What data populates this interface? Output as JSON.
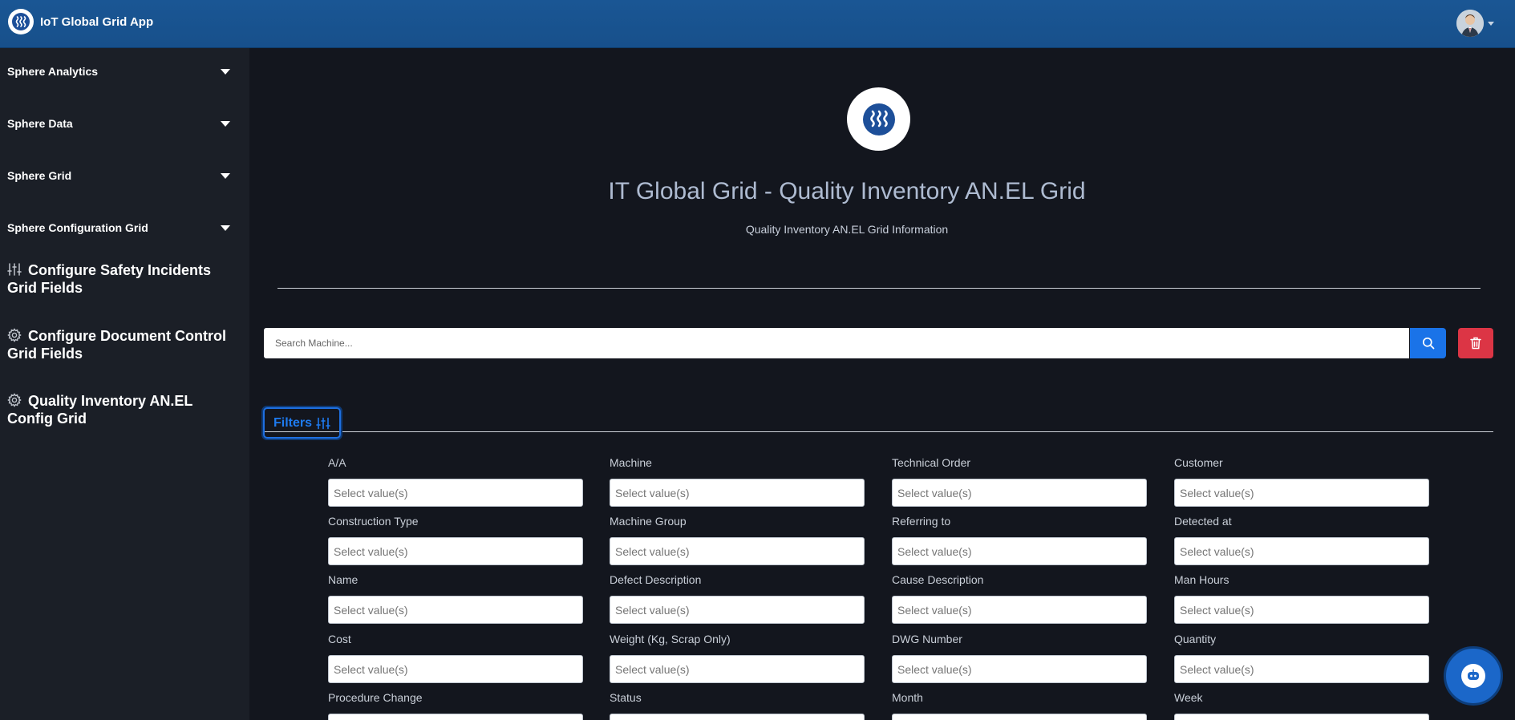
{
  "app": {
    "title": "IoT Global Grid App"
  },
  "sidebar": {
    "groups": [
      {
        "label": "Sphere Analytics"
      },
      {
        "label": "Sphere Data"
      },
      {
        "label": "Sphere Grid"
      },
      {
        "label": "Sphere Configuration Grid"
      }
    ],
    "links": [
      {
        "label": "Configure Safety Incidents Grid Fields",
        "icon": "sliders-icon"
      },
      {
        "label": "Configure Document Control Grid Fields",
        "icon": "gear-icon"
      },
      {
        "label": "Quality Inventory AN.EL Config Grid",
        "icon": "gear-icon"
      }
    ]
  },
  "hero": {
    "title": "IT Global Grid - Quality Inventory AN.EL Grid",
    "subtitle": "Quality Inventory AN.EL Grid Information"
  },
  "search": {
    "placeholder": "Search Machine...",
    "search_icon": "search-icon",
    "clear_icon": "trash-icon"
  },
  "filters": {
    "button_label": "Filters",
    "placeholder": "Select value(s)",
    "fields": [
      "A/A",
      "Machine",
      "Technical Order",
      "Customer",
      "Construction Type",
      "Machine Group",
      "Referring to",
      "Detected at",
      "Name",
      "Defect Description",
      "Cause Description",
      "Man Hours",
      "Cost",
      "Weight (Kg, Scrap Only)",
      "DWG Number",
      "Quantity",
      "Procedure Change",
      "Status",
      "Month",
      "Week"
    ]
  },
  "colors": {
    "topbar": "#1a5694",
    "sidebar": "#1b1f27",
    "background": "#13161e",
    "primary": "#1a73e8",
    "danger": "#dc3545"
  }
}
